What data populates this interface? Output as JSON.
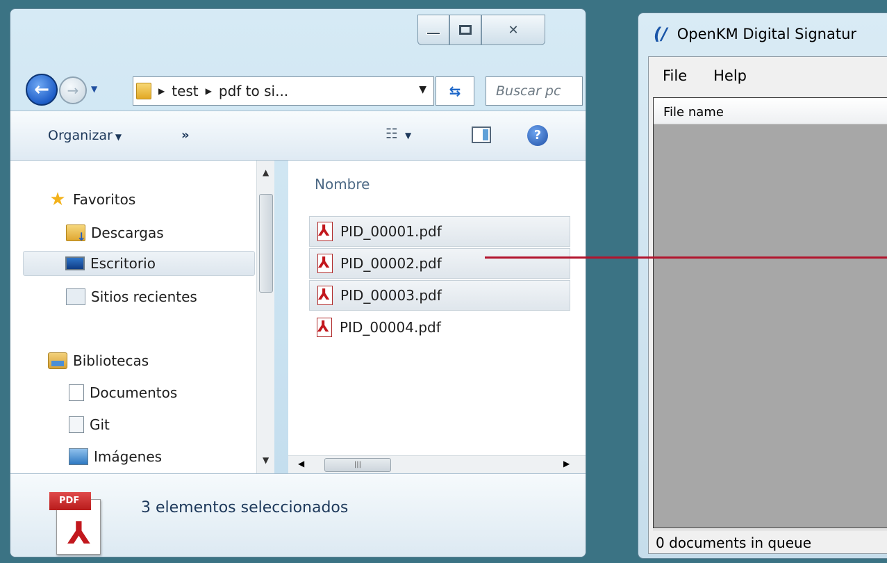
{
  "explorer": {
    "breadcrumb": [
      "test",
      "pdf to si..."
    ],
    "search_placeholder": "Buscar pc",
    "toolbar": {
      "organize": "Organizar",
      "more": "»"
    },
    "nav": {
      "favorites": "Favoritos",
      "downloads": "Descargas",
      "desktop": "Escritorio",
      "recent": "Sitios recientes",
      "libraries": "Bibliotecas",
      "documents": "Documentos",
      "git": "Git",
      "images": "Imágenes"
    },
    "column_header": "Nombre",
    "files": [
      "PID_00001.pdf",
      "PID_00002.pdf",
      "PID_00003.pdf",
      "PID_00004.pdf"
    ],
    "selected_files": [
      0,
      1,
      2
    ],
    "details": {
      "icon_tag": "PDF",
      "selection_text": "3 elementos seleccionados"
    }
  },
  "openkm": {
    "title": "OpenKM Digital Signatur",
    "menu": {
      "file": "File",
      "help": "Help"
    },
    "column_header": "File name",
    "status": "0 documents in queue"
  },
  "colors": {
    "accent_drag_line": "#b2142d",
    "desktop_bg": "#3b7384"
  }
}
